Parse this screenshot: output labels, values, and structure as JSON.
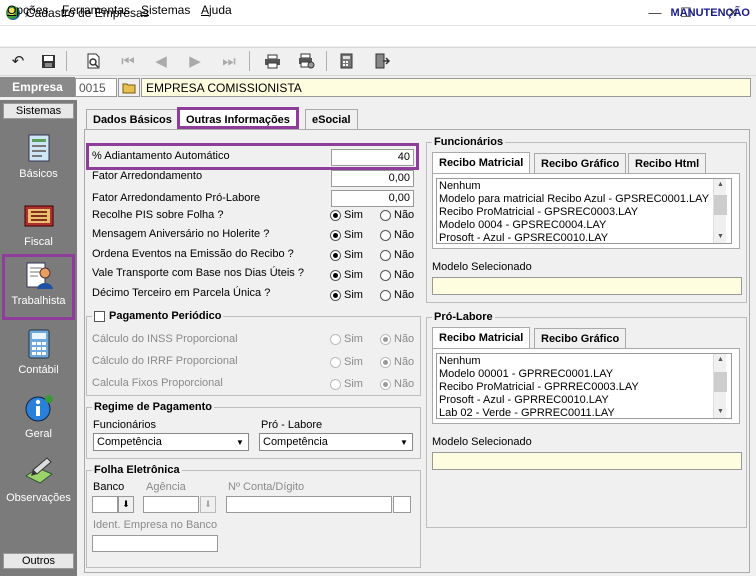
{
  "window": {
    "title": "Cadastro de Empresas",
    "minimize": "—",
    "maximize": "☐",
    "close": "✕"
  },
  "menu": {
    "items": [
      {
        "first": "O",
        "rest": "pções"
      },
      {
        "first": "F",
        "rest": "erramentas"
      },
      {
        "first": "S",
        "rest": "istemas"
      },
      {
        "first": "A",
        "rest": "juda"
      }
    ]
  },
  "toolbar": {
    "mode": "MANUTENÇÃO"
  },
  "empresa": {
    "label": "Empresa",
    "code": "0015",
    "name": "EMPRESA COMISSIONISTA"
  },
  "sidebar": {
    "header": "Sistemas",
    "footer": "Outros",
    "items": [
      "Básicos",
      "Fiscal",
      "Trabalhista",
      "Contábil",
      "Geral",
      "Observações"
    ]
  },
  "tabs": [
    "Dados Básicos",
    "Outras Informações",
    "eSocial"
  ],
  "form": {
    "adiantamento": {
      "label": "% Adiantamento Automático",
      "value": "40"
    },
    "arred": {
      "label": "Fator Arredondamento",
      "value": "0,00"
    },
    "arred_pl": {
      "label": "Fator Arredondamento Pró-Labore",
      "value": "0,00"
    },
    "yes": "Sim",
    "no": "Não",
    "questions": [
      "Recolhe PIS sobre Folha ?",
      "Mensagem Aniversário no Holerite ?",
      "Ordena Eventos na Emissão do Recibo ?",
      "Vale Transporte com Base nos Dias Úteis ?",
      "Décimo Terceiro em Parcela Única ?"
    ]
  },
  "periodico": {
    "title": "Pagamento Periódico",
    "items": [
      "Cálculo do INSS Proporcional",
      "Cálculo do IRRF Proporcional",
      "Calcula Fixos Proporcional"
    ]
  },
  "regime": {
    "title": "Regime de Pagamento",
    "func_label": "Funcionários",
    "func_value": "Competência",
    "pl_label": "Pró - Labore",
    "pl_value": "Competência"
  },
  "folha": {
    "title": "Folha Eletrônica",
    "banco": "Banco",
    "agencia": "Agência",
    "conta": "Nº Conta/Dígito",
    "ident": "Ident. Empresa no Banco"
  },
  "funcionarios": {
    "title": "Funcionários",
    "tabs": [
      "Recibo Matricial",
      "Recibo Gráfico",
      "Recibo Html"
    ],
    "list": [
      "Nenhum",
      "Modelo para matricial Recibo Azul - GPSREC0001.LAY",
      "Recibo ProMatricial - GPSREC0003.LAY",
      "Modelo 0004 - GPSREC0004.LAY",
      "Prosoft - Azul - GPSREC0010.LAY"
    ],
    "selected_label": "Modelo Selecionado"
  },
  "prolabore": {
    "title": "Pró-Labore",
    "tabs": [
      "Recibo Matricial",
      "Recibo Gráfico"
    ],
    "list": [
      "Nenhum",
      "Modelo 00001 - GPRREC0001.LAY",
      "Recibo ProMatricial - GPRREC0003.LAY",
      "Prosoft - Azul - GPRREC0010.LAY",
      "Lab 02 - Verde - GPRREC0011.LAY"
    ],
    "selected_label": "Modelo Selecionado"
  },
  "colors": {
    "highlight": "#8e3e9a",
    "sidebar": "#7b7b7b",
    "yellow_field": "#fffde0",
    "mode_text": "#1a1a8c"
  }
}
